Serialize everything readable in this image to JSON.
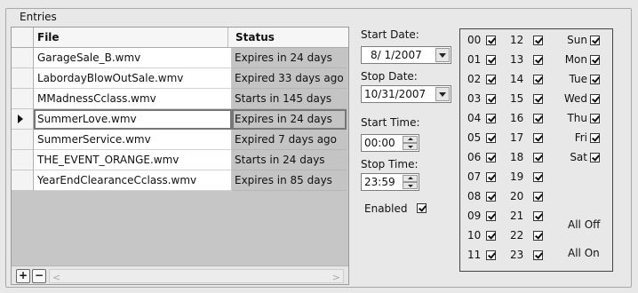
{
  "group_title": "Entries",
  "grid": {
    "columns": [
      "File",
      "Status"
    ],
    "rows": [
      {
        "file": "GarageSale_B.wmv",
        "status": "Expires in 24 days"
      },
      {
        "file": "LabordayBlowOutSale.wmv",
        "status": "Expired 33 days ago"
      },
      {
        "file": "MMadnessCclass.wmv",
        "status": "Starts in 145 days"
      },
      {
        "file": "SummerLove.wmv",
        "status": "Expires in 24 days"
      },
      {
        "file": "SummerService.wmv",
        "status": "Expired 7 days ago"
      },
      {
        "file": "THE_EVENT_ORANGE.wmv",
        "status": "Starts in 24 days"
      },
      {
        "file": "YearEndClearanceCclass.wmv",
        "status": "Expires in 85 days"
      }
    ],
    "selected_row": 3,
    "add_label": "+",
    "remove_label": "−"
  },
  "schedule": {
    "start_date_label": "Start Date:",
    "start_date": "8/ 1/2007",
    "stop_date_label": "Stop Date:",
    "stop_date": "10/31/2007",
    "start_time_label": "Start Time:",
    "start_time": "00:00",
    "stop_time_label": "Stop Time:",
    "stop_time": "23:59",
    "enabled_label": "Enabled",
    "enabled": true
  },
  "hours_left": [
    "00",
    "01",
    "02",
    "03",
    "04",
    "05",
    "06",
    "07",
    "08",
    "09",
    "10",
    "11"
  ],
  "hours_right": [
    "12",
    "13",
    "14",
    "15",
    "16",
    "17",
    "18",
    "19",
    "20",
    "21",
    "22",
    "23"
  ],
  "days": [
    "Sun",
    "Mon",
    "Tue",
    "Wed",
    "Thu",
    "Fri",
    "Sat"
  ],
  "all_off_label": "All Off",
  "all_on_label": "All On"
}
